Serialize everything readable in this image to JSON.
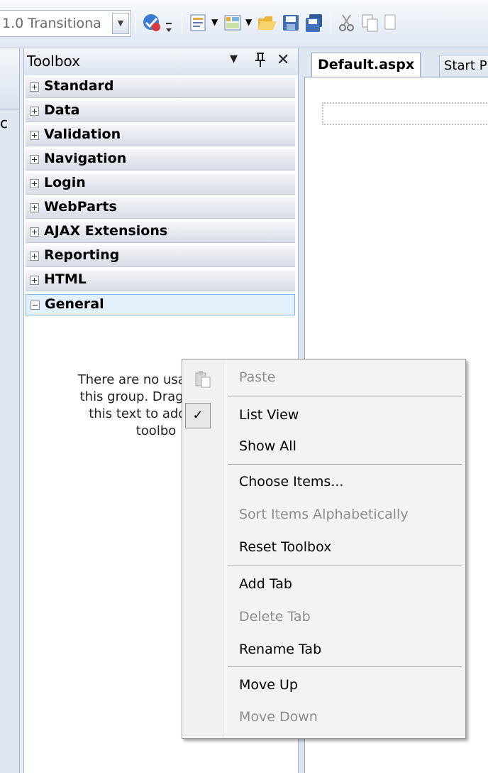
{
  "toolbar": {
    "doctype_combo_value": "1.0 Transitiona",
    "icons": [
      "browser-target-icon",
      "overflow-icon",
      "new-project-icon",
      "add-item-icon",
      "open-file-icon",
      "save-icon",
      "save-all-icon",
      "cut-icon",
      "copy-icon"
    ]
  },
  "left_strip": {
    "letter": "c"
  },
  "toolbox": {
    "title": "Toolbox",
    "dropdown_glyph": "▾",
    "pin_glyph": "⊥",
    "close_glyph": "✕",
    "groups": [
      {
        "label": "Standard",
        "expanded": false
      },
      {
        "label": "Data",
        "expanded": false
      },
      {
        "label": "Validation",
        "expanded": false
      },
      {
        "label": "Navigation",
        "expanded": false
      },
      {
        "label": "Login",
        "expanded": false
      },
      {
        "label": "WebParts",
        "expanded": false
      },
      {
        "label": "AJAX Extensions",
        "expanded": false
      },
      {
        "label": "Reporting",
        "expanded": false
      },
      {
        "label": "HTML",
        "expanded": false
      },
      {
        "label": "General",
        "expanded": true
      }
    ],
    "empty_message_lines": [
      "There are no usabl",
      "this group. Drag a",
      "this text to add",
      "toolbo"
    ]
  },
  "editor": {
    "tabs": [
      {
        "label": "Default.aspx",
        "active": true
      },
      {
        "label": "Start P",
        "active": false
      }
    ]
  },
  "context_menu": {
    "items": [
      {
        "label": "Paste",
        "enabled": false,
        "icon": "paste-icon"
      },
      {
        "label": "List View",
        "enabled": true,
        "checked": true
      },
      {
        "label": "Show All",
        "enabled": true
      },
      {
        "label": "Choose Items...",
        "enabled": true
      },
      {
        "label": "Sort Items Alphabetically",
        "enabled": false
      },
      {
        "label": "Reset Toolbox",
        "enabled": true
      },
      {
        "label": "Add Tab",
        "enabled": true
      },
      {
        "label": "Delete Tab",
        "enabled": false
      },
      {
        "label": "Rename Tab",
        "enabled": true
      },
      {
        "label": "Move Up",
        "enabled": true
      },
      {
        "label": "Move Down",
        "enabled": false
      }
    ],
    "check_glyph": "✓"
  },
  "colors": {
    "selected_group_bg": "#e1f0fb",
    "selected_group_border": "#7db7e6",
    "disabled_text": "#8d8d8d"
  }
}
